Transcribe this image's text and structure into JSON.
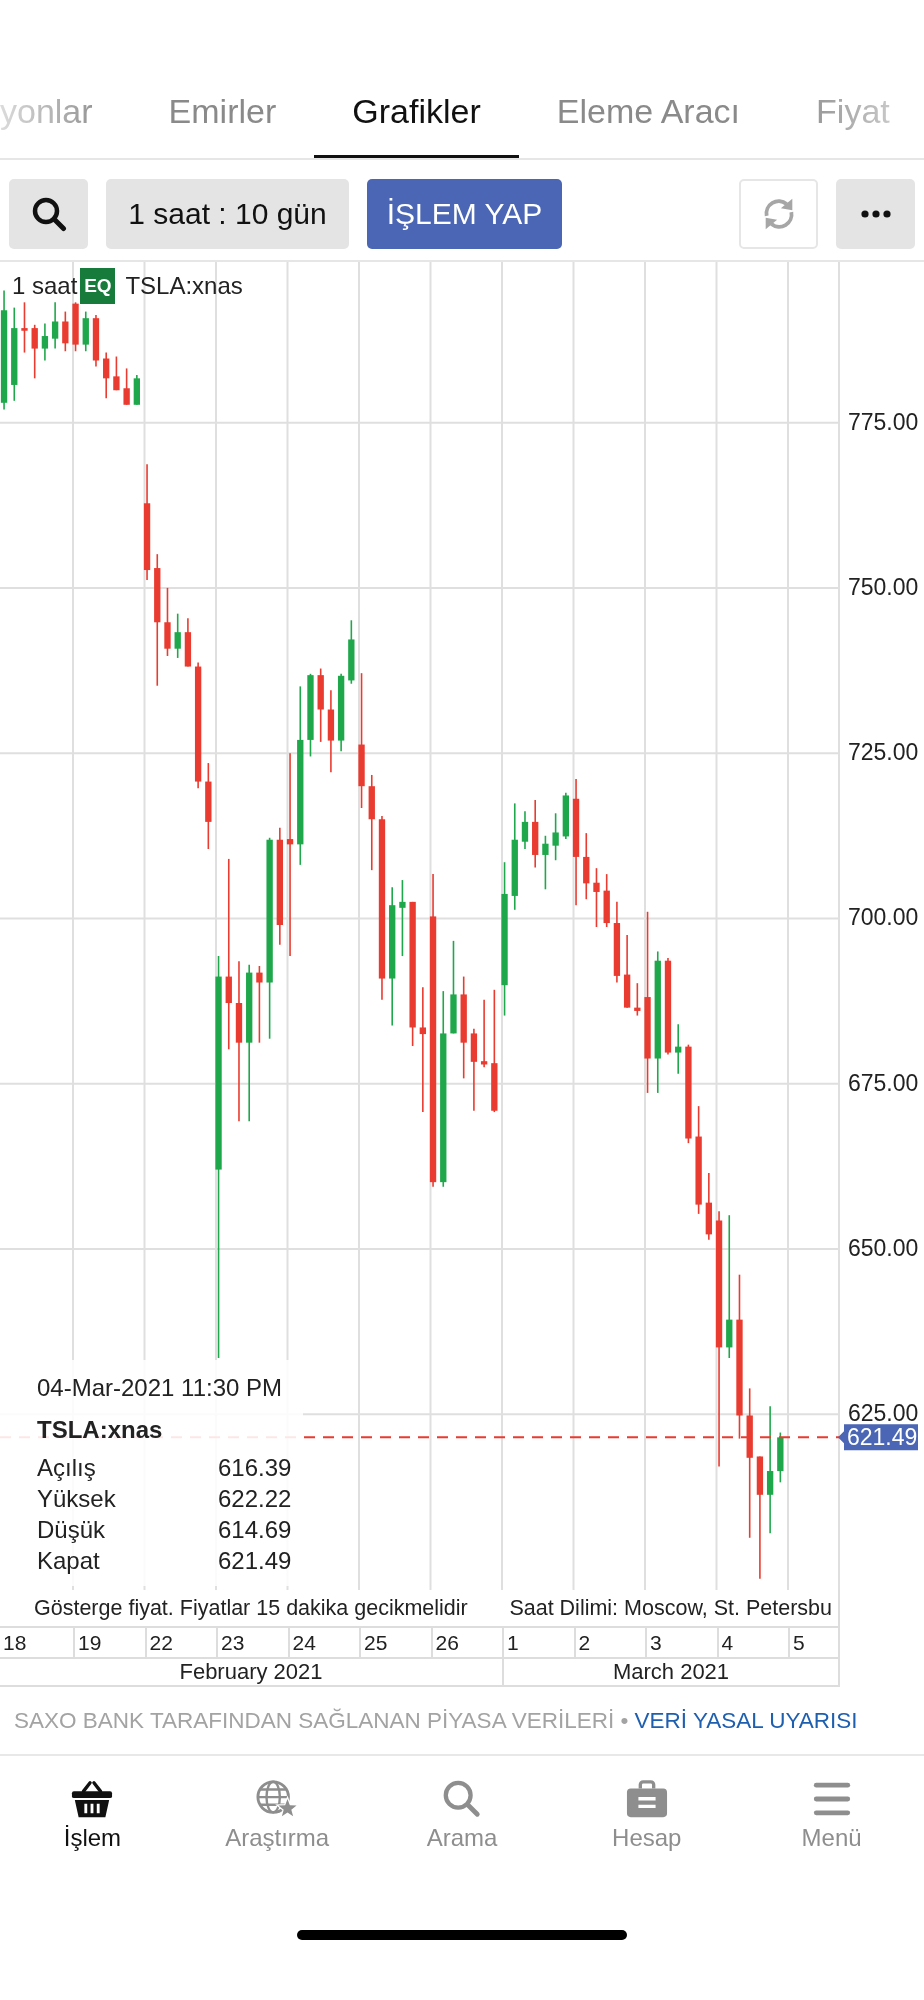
{
  "tabs": [
    {
      "label": "yonlar",
      "selected": false
    },
    {
      "label": "Emirler",
      "selected": false
    },
    {
      "label": "Grafikler",
      "selected": true
    },
    {
      "label": "Eleme Aracı",
      "selected": false
    },
    {
      "label": "Fiyat",
      "selected": false
    }
  ],
  "toolbar": {
    "interval": "1 saat : 10 gün",
    "trade_button": "İŞLEM YAP"
  },
  "chart": {
    "interval": "1 saat",
    "instrument_type": "EQ",
    "symbol": "TSLA:xnas",
    "chart_data": {
      "type": "candlestick",
      "categories": [
        null,
        "18",
        null,
        null,
        null,
        null,
        null,
        null,
        "19",
        null,
        null,
        null,
        null,
        null,
        null,
        "22",
        null,
        null,
        null,
        null,
        null,
        null,
        "23",
        null,
        null,
        null,
        null,
        null,
        null,
        "24",
        null,
        null,
        null,
        null,
        null,
        null,
        "25",
        null,
        null,
        null,
        null,
        null,
        null,
        "26",
        null,
        null,
        null,
        null,
        null,
        null,
        "1",
        null,
        null,
        null,
        null,
        null,
        null,
        "2",
        null,
        null,
        null,
        null,
        null,
        null,
        "3",
        null,
        null,
        null,
        null,
        null,
        null,
        "4",
        null,
        null,
        null,
        null,
        null,
        null,
        "5"
      ],
      "ohlc": [
        [
          778,
          795,
          777,
          792
        ],
        [
          780.7,
          792.4,
          778.3,
          789.3
        ],
        [
          789.3,
          793.2,
          785.6,
          788.9
        ],
        [
          789.3,
          789.8,
          781.7,
          786.2
        ],
        [
          786.2,
          790,
          784.4,
          788.1
        ],
        [
          787.7,
          793.2,
          786.2,
          790.3
        ],
        [
          790.3,
          791.8,
          785.8,
          787.0
        ],
        [
          793.0,
          793.2,
          785.8,
          786.8
        ],
        [
          786.8,
          791.8,
          785.8,
          790.8
        ],
        [
          790.8,
          791.3,
          783.5,
          784.4
        ],
        [
          784.7,
          785.6,
          778.7,
          781.7
        ],
        [
          782,
          785,
          779.9,
          779.9
        ],
        [
          780.2,
          783.2,
          777.7,
          777.7
        ],
        [
          777.7,
          782.2,
          777.7,
          781.7
        ],
        [
          762.8,
          768.7,
          751.2,
          752.7
        ],
        [
          753,
          755.1,
          735.2,
          744.8
        ],
        [
          744.8,
          750,
          739.7,
          740.8
        ],
        [
          740.8,
          746.1,
          739.4,
          743.3
        ],
        [
          743.3,
          745.4,
          738.1,
          738.1
        ],
        [
          738.1,
          738.7,
          719.7,
          720.7
        ],
        [
          720.7,
          723.5,
          710.5,
          714.6
        ],
        [
          662,
          694.3,
          633.5,
          691.2
        ],
        [
          691.2,
          709,
          680.2,
          687.2
        ],
        [
          687.2,
          693.5,
          669.3,
          681.2
        ],
        [
          681.2,
          693,
          669.3,
          691.8
        ],
        [
          691.8,
          692.8,
          681.2,
          690.3
        ],
        [
          690.3,
          712.2,
          681.8,
          711.9
        ],
        [
          711.9,
          713.7,
          696,
          699
        ],
        [
          712,
          725,
          694.3,
          711.2
        ],
        [
          711.2,
          735.1,
          708.1,
          727
        ],
        [
          727,
          737,
          724.5,
          736.8
        ],
        [
          736.8,
          737.8,
          726.7,
          731.6
        ],
        [
          731.6,
          734.5,
          722.1,
          726.9
        ],
        [
          726.9,
          737,
          725.3,
          736.7
        ],
        [
          736,
          745.1,
          735.5,
          742.2
        ],
        [
          726.3,
          737.1,
          716.7,
          720
        ],
        [
          720,
          721.7,
          707.3,
          715
        ],
        [
          715,
          715.5,
          687.7,
          690.9
        ],
        [
          690.9,
          704.7,
          683.8,
          702
        ],
        [
          701.6,
          705.8,
          694.3,
          702.5
        ],
        [
          702.5,
          702.5,
          680.7,
          683.5
        ],
        [
          683.5,
          689.6,
          670.7,
          682.5
        ],
        [
          700.3,
          706.7,
          659.4,
          660.1
        ],
        [
          660.1,
          689,
          659.4,
          682.6
        ],
        [
          682.6,
          696.6,
          682.6,
          688.5
        ],
        [
          688.5,
          691.2,
          675.8,
          681.2
        ],
        [
          682.6,
          683.3,
          670.9,
          678.3
        ],
        [
          678.4,
          687.7,
          677.5,
          677.9
        ],
        [
          678.1,
          689.2,
          670.7,
          670.9
        ],
        [
          689.9,
          708.5,
          685.3,
          703.7
        ],
        [
          703.4,
          717.4,
          701.3,
          711.9
        ],
        [
          711.6,
          716.2,
          710.5,
          714.6
        ],
        [
          714.6,
          717.9,
          707.7,
          709.6
        ],
        [
          709.6,
          712.5,
          704.4,
          711.3
        ],
        [
          711,
          715.9,
          708.8,
          713
        ],
        [
          712.4,
          719,
          712,
          718.6
        ],
        [
          718.1,
          721.1,
          702,
          709.3
        ],
        [
          709.3,
          712.9,
          702.9,
          705.3
        ],
        [
          705.4,
          707.6,
          698.7,
          704
        ],
        [
          704.2,
          706.7,
          698.7,
          699.3
        ],
        [
          699.3,
          702.5,
          690.3,
          691.3
        ],
        [
          691.5,
          697.5,
          686.5,
          686.5
        ],
        [
          686.5,
          690.2,
          685.3,
          686
        ],
        [
          688.1,
          701,
          673.6,
          678.8
        ],
        [
          678.8,
          695,
          673.6,
          693.6
        ],
        [
          693.6,
          694,
          679.4,
          679.7
        ],
        [
          679.7,
          684,
          676.5,
          680.6
        ],
        [
          680.6,
          680.9,
          666,
          666.7
        ],
        [
          667,
          671.6,
          655.3,
          656.7
        ],
        [
          657,
          661.5,
          651.4,
          652.2
        ],
        [
          654.3,
          655.7,
          617.1,
          635.1
        ],
        [
          635.1,
          655.1,
          633.5,
          639.3
        ],
        [
          639.3,
          646.1,
          621.3,
          624.8
        ],
        [
          624.8,
          628.9,
          606.3,
          618.4
        ],
        [
          618.6,
          618.6,
          600.1,
          612.8
        ],
        [
          612.8,
          626.2,
          607,
          616.4
        ],
        [
          616.39,
          622.22,
          614.69,
          621.49
        ],
        null,
        null
      ],
      "ylim": [
        598.4,
        799.3
      ],
      "yticks": [
        {
          "value": 775,
          "label": "775.00"
        },
        {
          "value": 750,
          "label": "750.00"
        },
        {
          "value": 725,
          "label": "725.00"
        },
        {
          "value": 700,
          "label": "700.00"
        },
        {
          "value": 675,
          "label": "675.00"
        },
        {
          "value": 650,
          "label": "650.00"
        },
        {
          "value": 625,
          "label": "625.00"
        }
      ],
      "grid": true,
      "ref_lines": [
        {
          "axis": "y",
          "value": 621.49,
          "label": "621.49"
        }
      ]
    },
    "info": {
      "timestamp": "04-Mar-2021 11:30 PM",
      "symbol": "TSLA:xnas",
      "rows": [
        {
          "label": "Açılış",
          "value": "616.39"
        },
        {
          "label": "Yüksek",
          "value": "622.22"
        },
        {
          "label": "Düşük",
          "value": "614.69"
        },
        {
          "label": "Kapat",
          "value": "621.49"
        }
      ]
    },
    "notes": [
      "Gösterge fiyat. Fiyatlar 15 dakika gecikmelidir",
      "Saat Dilimi: Moscow, St. Petersbu"
    ],
    "months": [
      {
        "label": "February 2021"
      },
      {
        "label": "March 2021"
      }
    ]
  },
  "footer": {
    "source": "SAXO BANK TARAFINDAN SAĞLANAN PİYASA VERİLERİ",
    "separator": "•",
    "link": "VERİ YASAL UYARISI"
  },
  "nav": [
    {
      "label": "İşlem",
      "selected": true
    },
    {
      "label": "Araştırma",
      "selected": false
    },
    {
      "label": "Arama",
      "selected": false
    },
    {
      "label": "Hesap",
      "selected": false
    },
    {
      "label": "Menü",
      "selected": false
    }
  ]
}
